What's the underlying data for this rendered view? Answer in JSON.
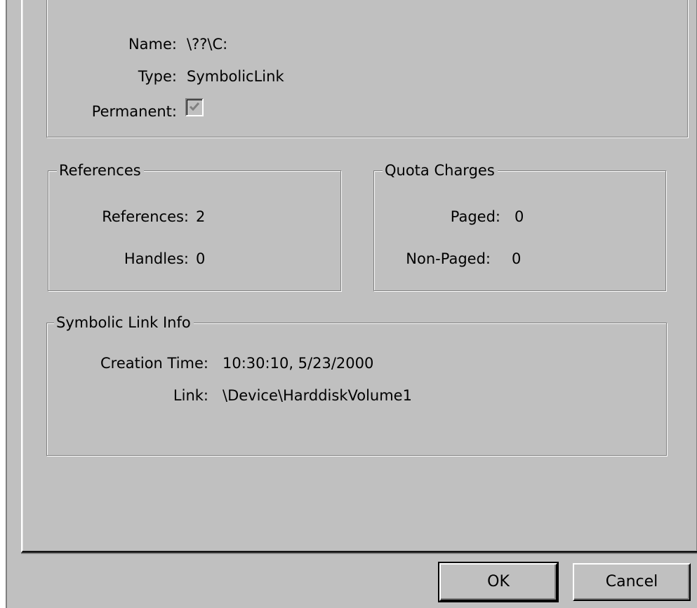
{
  "general": {
    "name_label": "Name:",
    "name_value": "\\??\\C:",
    "type_label": "Type:",
    "type_value": "SymbolicLink",
    "permanent_label": "Permanent:",
    "permanent_checked": true
  },
  "references": {
    "title": "References",
    "references_label": "References:",
    "references_value": "2",
    "handles_label": "Handles:",
    "handles_value": "0"
  },
  "quota": {
    "title": "Quota Charges",
    "paged_label": "Paged:",
    "paged_value": "0",
    "nonpaged_label": "Non-Paged:",
    "nonpaged_value": "0"
  },
  "symlink": {
    "title": "Symbolic Link Info",
    "creation_label": "Creation Time:",
    "creation_value": "10:30:10, 5/23/2000",
    "link_label": "Link:",
    "link_value": "\\Device\\HarddiskVolume1"
  },
  "buttons": {
    "ok": "OK",
    "cancel": "Cancel"
  }
}
